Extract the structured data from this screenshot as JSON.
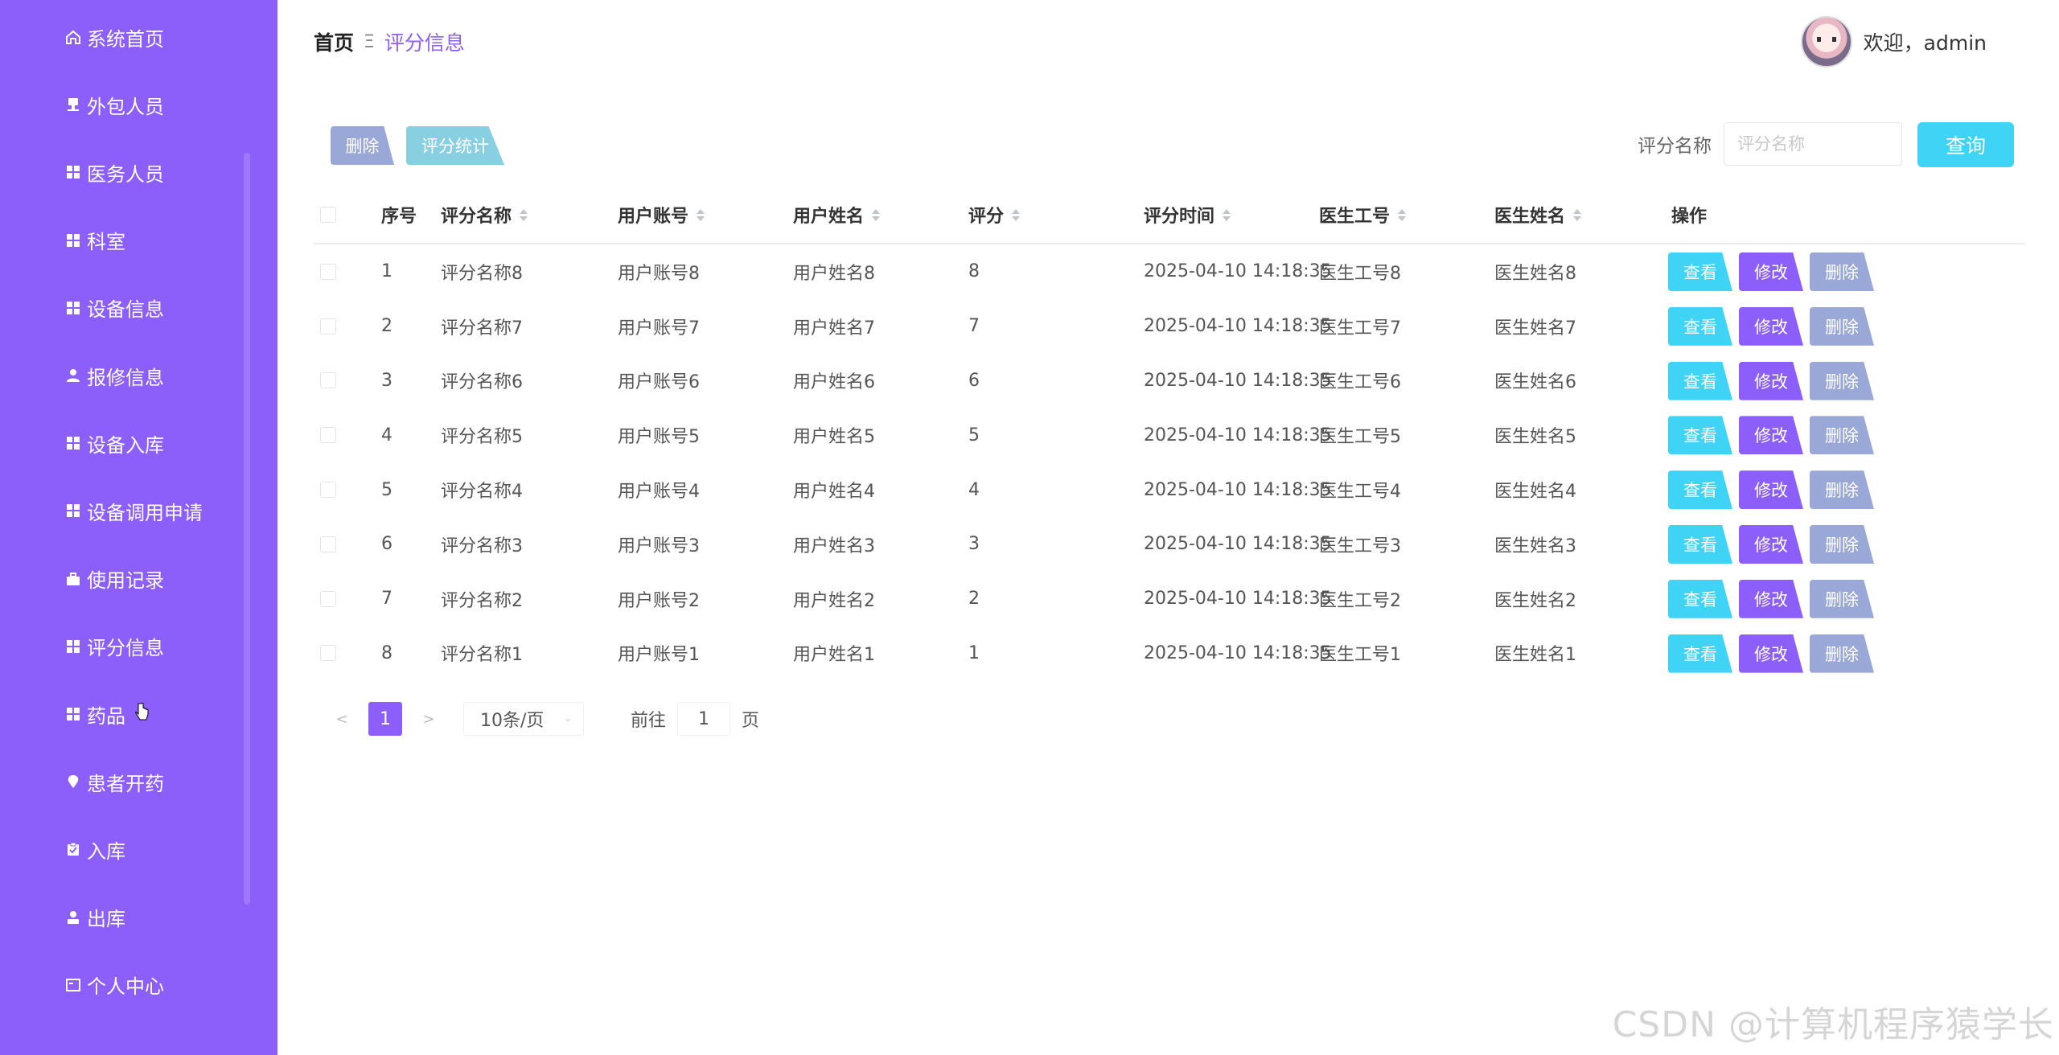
{
  "sidebar": {
    "items": [
      {
        "label": "系统首页",
        "icon": "home-icon"
      },
      {
        "label": "外包人员",
        "icon": "stamp-icon"
      },
      {
        "label": "医务人员",
        "icon": "grid-icon"
      },
      {
        "label": "科室",
        "icon": "grid-icon"
      },
      {
        "label": "设备信息",
        "icon": "grid-icon"
      },
      {
        "label": "报修信息",
        "icon": "user-icon"
      },
      {
        "label": "设备入库",
        "icon": "grid-icon"
      },
      {
        "label": "设备调用申请",
        "icon": "grid-icon"
      },
      {
        "label": "使用记录",
        "icon": "briefcase-icon"
      },
      {
        "label": "评分信息",
        "icon": "grid-icon"
      },
      {
        "label": "药品",
        "icon": "grid-icon"
      },
      {
        "label": "患者开药",
        "icon": "pin-icon"
      },
      {
        "label": "入库",
        "icon": "clipboard-icon"
      },
      {
        "label": "出库",
        "icon": "stamp-user-icon"
      },
      {
        "label": "个人中心",
        "icon": "profile-icon"
      }
    ]
  },
  "header": {
    "breadcrumb_home": "首页",
    "breadcrumb_sep": "Ξ",
    "breadcrumb_current": "评分信息",
    "welcome": "欢迎，admin"
  },
  "toolbar": {
    "delete_label": "删除",
    "stats_label": "评分统计",
    "search_label": "评分名称",
    "search_placeholder": "评分名称",
    "search_value": "",
    "query_label": "查询"
  },
  "table": {
    "columns": [
      "序号",
      "评分名称",
      "用户账号",
      "用户姓名",
      "评分",
      "评分时间",
      "医生工号",
      "医生姓名",
      "操作"
    ],
    "rows": [
      {
        "idx": "1",
        "name": "评分名称8",
        "account": "用户账号8",
        "username": "用户姓名8",
        "score": "8",
        "time": "2025-04-10 14:18:35",
        "doc_id": "医生工号8",
        "doc_name": "医生姓名8"
      },
      {
        "idx": "2",
        "name": "评分名称7",
        "account": "用户账号7",
        "username": "用户姓名7",
        "score": "7",
        "time": "2025-04-10 14:18:35",
        "doc_id": "医生工号7",
        "doc_name": "医生姓名7"
      },
      {
        "idx": "3",
        "name": "评分名称6",
        "account": "用户账号6",
        "username": "用户姓名6",
        "score": "6",
        "time": "2025-04-10 14:18:35",
        "doc_id": "医生工号6",
        "doc_name": "医生姓名6"
      },
      {
        "idx": "4",
        "name": "评分名称5",
        "account": "用户账号5",
        "username": "用户姓名5",
        "score": "5",
        "time": "2025-04-10 14:18:35",
        "doc_id": "医生工号5",
        "doc_name": "医生姓名5"
      },
      {
        "idx": "5",
        "name": "评分名称4",
        "account": "用户账号4",
        "username": "用户姓名4",
        "score": "4",
        "time": "2025-04-10 14:18:35",
        "doc_id": "医生工号4",
        "doc_name": "医生姓名4"
      },
      {
        "idx": "6",
        "name": "评分名称3",
        "account": "用户账号3",
        "username": "用户姓名3",
        "score": "3",
        "time": "2025-04-10 14:18:35",
        "doc_id": "医生工号3",
        "doc_name": "医生姓名3"
      },
      {
        "idx": "7",
        "name": "评分名称2",
        "account": "用户账号2",
        "username": "用户姓名2",
        "score": "2",
        "time": "2025-04-10 14:18:35",
        "doc_id": "医生工号2",
        "doc_name": "医生姓名2"
      },
      {
        "idx": "8",
        "name": "评分名称1",
        "account": "用户账号1",
        "username": "用户姓名1",
        "score": "1",
        "time": "2025-04-10 14:18:35",
        "doc_id": "医生工号1",
        "doc_name": "医生姓名1"
      }
    ],
    "actions": {
      "view": "查看",
      "edit": "修改",
      "delete": "删除"
    }
  },
  "pagination": {
    "prev": "<",
    "current_page": "1",
    "next": ">",
    "page_size": "10条/页",
    "goto_label": "前往",
    "goto_value": "1",
    "page_suffix": "页"
  },
  "watermark": "CSDN @计算机程序猿学长",
  "colors": {
    "sidebar_bg": "#8c5ffb",
    "accent_cyan": "#3fd4f6",
    "accent_purple": "#8c5ffb",
    "muted_blue": "#9aa8d8"
  }
}
